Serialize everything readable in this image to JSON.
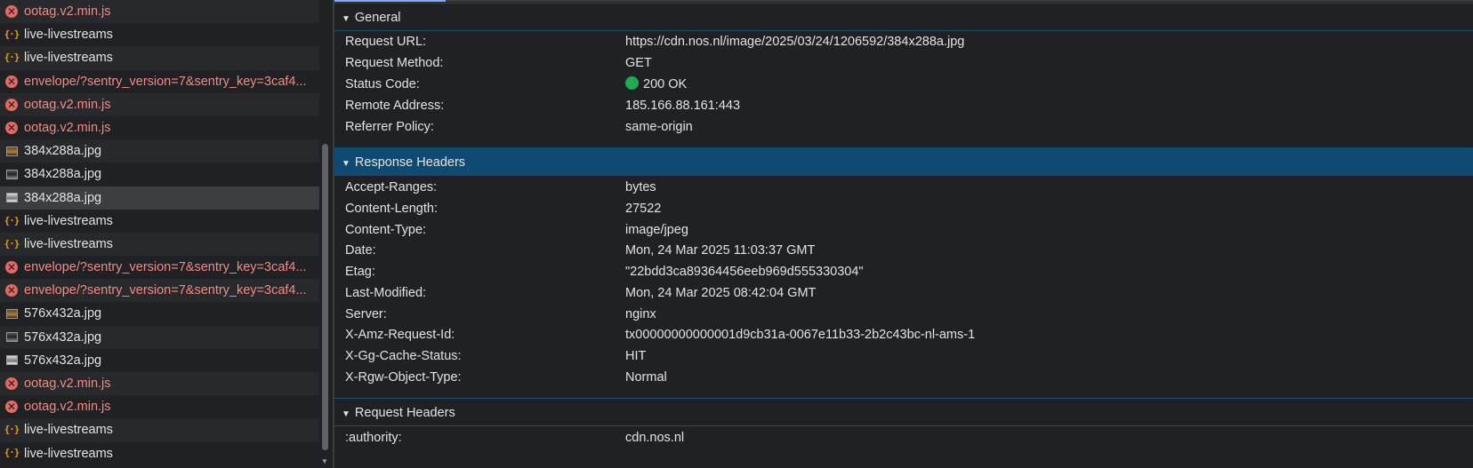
{
  "requests": [
    {
      "name": "ootag.v2.min.js",
      "type": "error"
    },
    {
      "name": "live-livestreams",
      "type": "json"
    },
    {
      "name": "live-livestreams",
      "type": "json"
    },
    {
      "name": "envelope/?sentry_version=7&sentry_key=3caf4...",
      "type": "error"
    },
    {
      "name": "ootag.v2.min.js",
      "type": "error"
    },
    {
      "name": "ootag.v2.min.js",
      "type": "error"
    },
    {
      "name": "384x288a.jpg",
      "type": "image"
    },
    {
      "name": "384x288a.jpg",
      "type": "image-dark"
    },
    {
      "name": "384x288a.jpg",
      "type": "image-light",
      "selected": true
    },
    {
      "name": "live-livestreams",
      "type": "json"
    },
    {
      "name": "live-livestreams",
      "type": "json"
    },
    {
      "name": "envelope/?sentry_version=7&sentry_key=3caf4...",
      "type": "error"
    },
    {
      "name": "envelope/?sentry_version=7&sentry_key=3caf4...",
      "type": "error"
    },
    {
      "name": "576x432a.jpg",
      "type": "image"
    },
    {
      "name": "576x432a.jpg",
      "type": "image-dark"
    },
    {
      "name": "576x432a.jpg",
      "type": "image-light"
    },
    {
      "name": "ootag.v2.min.js",
      "type": "error"
    },
    {
      "name": "ootag.v2.min.js",
      "type": "error"
    },
    {
      "name": "live-livestreams",
      "type": "json"
    },
    {
      "name": "live-livestreams",
      "type": "json"
    }
  ],
  "general": {
    "title": "General",
    "request_url_label": "Request URL:",
    "request_url": "https://cdn.nos.nl/image/2025/03/24/1206592/384x288a.jpg",
    "method_label": "Request Method:",
    "method": "GET",
    "status_label": "Status Code:",
    "status": "200 OK",
    "status_color": "#1eaa52",
    "remote_label": "Remote Address:",
    "remote": "185.166.88.161:443",
    "referrer_label": "Referrer Policy:",
    "referrer": "same-origin"
  },
  "response_headers": {
    "title": "Response Headers",
    "items": [
      {
        "k": "Accept-Ranges:",
        "v": "bytes"
      },
      {
        "k": "Content-Length:",
        "v": "27522"
      },
      {
        "k": "Content-Type:",
        "v": "image/jpeg"
      },
      {
        "k": "Date:",
        "v": "Mon, 24 Mar 2025 11:03:37 GMT"
      },
      {
        "k": "Etag:",
        "v": "\"22bdd3ca89364456eeb969d555330304\""
      },
      {
        "k": "Last-Modified:",
        "v": "Mon, 24 Mar 2025 08:42:04 GMT"
      },
      {
        "k": "Server:",
        "v": "nginx"
      },
      {
        "k": "X-Amz-Request-Id:",
        "v": "tx00000000000001d9cb31a-0067e11b33-2b2c43bc-nl-ams-1"
      },
      {
        "k": "X-Gg-Cache-Status:",
        "v": "HIT"
      },
      {
        "k": "X-Rgw-Object-Type:",
        "v": "Normal"
      }
    ]
  },
  "request_headers": {
    "title": "Request Headers",
    "items": [
      {
        "k": ":authority:",
        "v": "cdn.nos.nl"
      }
    ]
  }
}
